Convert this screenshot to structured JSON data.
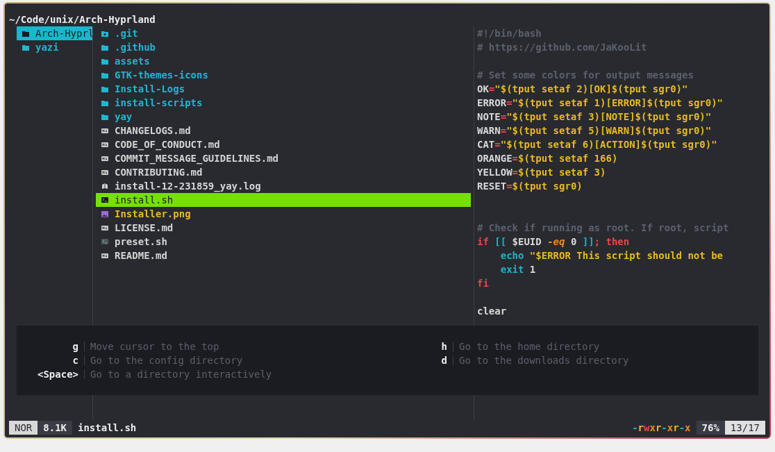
{
  "path": "~/Code/unix/Arch-Hyprland",
  "parent_items": [
    {
      "name": "Arch-Hyprl",
      "kind": "folder",
      "selected": true
    },
    {
      "name": "yazi",
      "kind": "folder",
      "selected": false
    }
  ],
  "files": [
    {
      "name": ".git",
      "kind": "git",
      "selected": false
    },
    {
      "name": ".github",
      "kind": "folder",
      "selected": false
    },
    {
      "name": "assets",
      "kind": "folder",
      "selected": false
    },
    {
      "name": "GTK-themes-icons",
      "kind": "folder",
      "selected": false
    },
    {
      "name": "Install-Logs",
      "kind": "folder",
      "selected": false
    },
    {
      "name": "install-scripts",
      "kind": "folder",
      "selected": false
    },
    {
      "name": "yay",
      "kind": "folder",
      "selected": false
    },
    {
      "name": "CHANGELOGS.md",
      "kind": "markdown",
      "selected": false
    },
    {
      "name": "CODE_OF_CONDUCT.md",
      "kind": "markdown",
      "selected": false
    },
    {
      "name": "COMMIT_MESSAGE_GUIDELINES.md",
      "kind": "markdown",
      "selected": false
    },
    {
      "name": "CONTRIBUTING.md",
      "kind": "markdown",
      "selected": false
    },
    {
      "name": "install-12-231859_yay.log",
      "kind": "log",
      "selected": false
    },
    {
      "name": "install.sh",
      "kind": "shell",
      "selected": true
    },
    {
      "name": "Installer.png",
      "kind": "image",
      "selected": false
    },
    {
      "name": "LICENSE.md",
      "kind": "markdown",
      "selected": false
    },
    {
      "name": "preset.sh",
      "kind": "shell",
      "selected": false
    },
    {
      "name": "README.md",
      "kind": "markdown",
      "selected": false
    }
  ],
  "preview_lines": [
    {
      "kind": "code",
      "segments": [
        {
          "text": "#!/bin/bash",
          "kind": "comment"
        }
      ]
    },
    {
      "kind": "code",
      "segments": [
        {
          "text": "# https://github.com/JaKooLit",
          "kind": "comment"
        }
      ]
    },
    {
      "kind": "blank"
    },
    {
      "kind": "code",
      "segments": [
        {
          "text": "# Set some colors for output messages",
          "kind": "comment"
        }
      ]
    },
    {
      "kind": "code",
      "segments": [
        {
          "text": "OK",
          "kind": "plain"
        },
        {
          "text": "=",
          "kind": "operator"
        },
        {
          "text": "\"$(tput setaf 2)[OK]$(tput sgr0)\"",
          "kind": "string"
        }
      ]
    },
    {
      "kind": "code",
      "segments": [
        {
          "text": "ERROR",
          "kind": "plain"
        },
        {
          "text": "=",
          "kind": "operator"
        },
        {
          "text": "\"$(tput setaf 1)[ERROR]$(tput sgr0)\"",
          "kind": "string"
        }
      ]
    },
    {
      "kind": "code",
      "segments": [
        {
          "text": "NOTE",
          "kind": "plain"
        },
        {
          "text": "=",
          "kind": "operator"
        },
        {
          "text": "\"$(tput setaf 3)[NOTE]$(tput sgr0)\"",
          "kind": "string"
        }
      ]
    },
    {
      "kind": "code",
      "segments": [
        {
          "text": "WARN",
          "kind": "plain"
        },
        {
          "text": "=",
          "kind": "operator"
        },
        {
          "text": "\"$(tput setaf 5)[WARN]$(tput sgr0)\"",
          "kind": "string"
        }
      ]
    },
    {
      "kind": "code",
      "segments": [
        {
          "text": "CAT",
          "kind": "plain"
        },
        {
          "text": "=",
          "kind": "operator"
        },
        {
          "text": "\"$(tput setaf 6)[ACTION]$(tput sgr0)\"",
          "kind": "string"
        }
      ]
    },
    {
      "kind": "code",
      "segments": [
        {
          "text": "ORANGE",
          "kind": "plain"
        },
        {
          "text": "=",
          "kind": "operator"
        },
        {
          "text": "$(tput setaf 166)",
          "kind": "string"
        }
      ]
    },
    {
      "kind": "code",
      "segments": [
        {
          "text": "YELLOW",
          "kind": "plain"
        },
        {
          "text": "=",
          "kind": "operator"
        },
        {
          "text": "$(tput setaf 3)",
          "kind": "string"
        }
      ]
    },
    {
      "kind": "code",
      "segments": [
        {
          "text": "RESET",
          "kind": "plain"
        },
        {
          "text": "=",
          "kind": "operator"
        },
        {
          "text": "$(tput sgr0)",
          "kind": "string"
        }
      ]
    },
    {
      "kind": "blank"
    },
    {
      "kind": "blank"
    },
    {
      "kind": "code",
      "segments": [
        {
          "text": "# Check if running as root. If root, script",
          "kind": "comment"
        }
      ]
    },
    {
      "kind": "code",
      "segments": [
        {
          "text": "if ",
          "kind": "keyword"
        },
        {
          "text": "[[",
          "kind": "bracket"
        },
        {
          "text": " $EUID ",
          "kind": "plain"
        },
        {
          "text": "-eq",
          "kind": "flag"
        },
        {
          "text": " 0 ",
          "kind": "plain"
        },
        {
          "text": "]]",
          "kind": "bracket"
        },
        {
          "text": "; then",
          "kind": "keyword"
        }
      ]
    },
    {
      "kind": "code",
      "segments": [
        {
          "text": "    echo ",
          "kind": "builtin"
        },
        {
          "text": "\"$ERROR This script should not be",
          "kind": "string"
        }
      ]
    },
    {
      "kind": "code",
      "segments": [
        {
          "text": "    exit",
          "kind": "builtin"
        },
        {
          "text": " 1",
          "kind": "plain"
        }
      ]
    },
    {
      "kind": "code",
      "segments": [
        {
          "text": "fi",
          "kind": "keyword"
        }
      ]
    },
    {
      "kind": "blank"
    },
    {
      "kind": "code",
      "segments": [
        {
          "text": "clear",
          "kind": "plain"
        }
      ]
    }
  ],
  "help": {
    "left": [
      {
        "key": "g",
        "desc": "Move cursor to the top"
      },
      {
        "key": "c",
        "desc": "Go to the config directory"
      },
      {
        "key": "<Space>",
        "desc": "Go to a directory interactively"
      }
    ],
    "right": [
      {
        "key": "h",
        "desc": "Go to the home directory"
      },
      {
        "key": "d",
        "desc": "Go to the downloads directory"
      }
    ]
  },
  "status_bar": {
    "mode": "NOR",
    "size": "8.1K",
    "filename": "install.sh",
    "permissions": [
      {
        "char": "-",
        "color": "#1fb3c8"
      },
      {
        "char": "r",
        "color": "#e8b923"
      },
      {
        "char": "w",
        "color": "#e5484d"
      },
      {
        "char": "x",
        "color": "#f08c1f"
      },
      {
        "char": "r",
        "color": "#e8b923"
      },
      {
        "char": "-",
        "color": "#1fb3c8"
      },
      {
        "char": "x",
        "color": "#f08c1f"
      },
      {
        "char": "r",
        "color": "#e8b923"
      },
      {
        "char": "-",
        "color": "#1fb3c8"
      },
      {
        "char": "x",
        "color": "#f08c1f"
      }
    ],
    "percent": "76%",
    "position": "13/17"
  }
}
